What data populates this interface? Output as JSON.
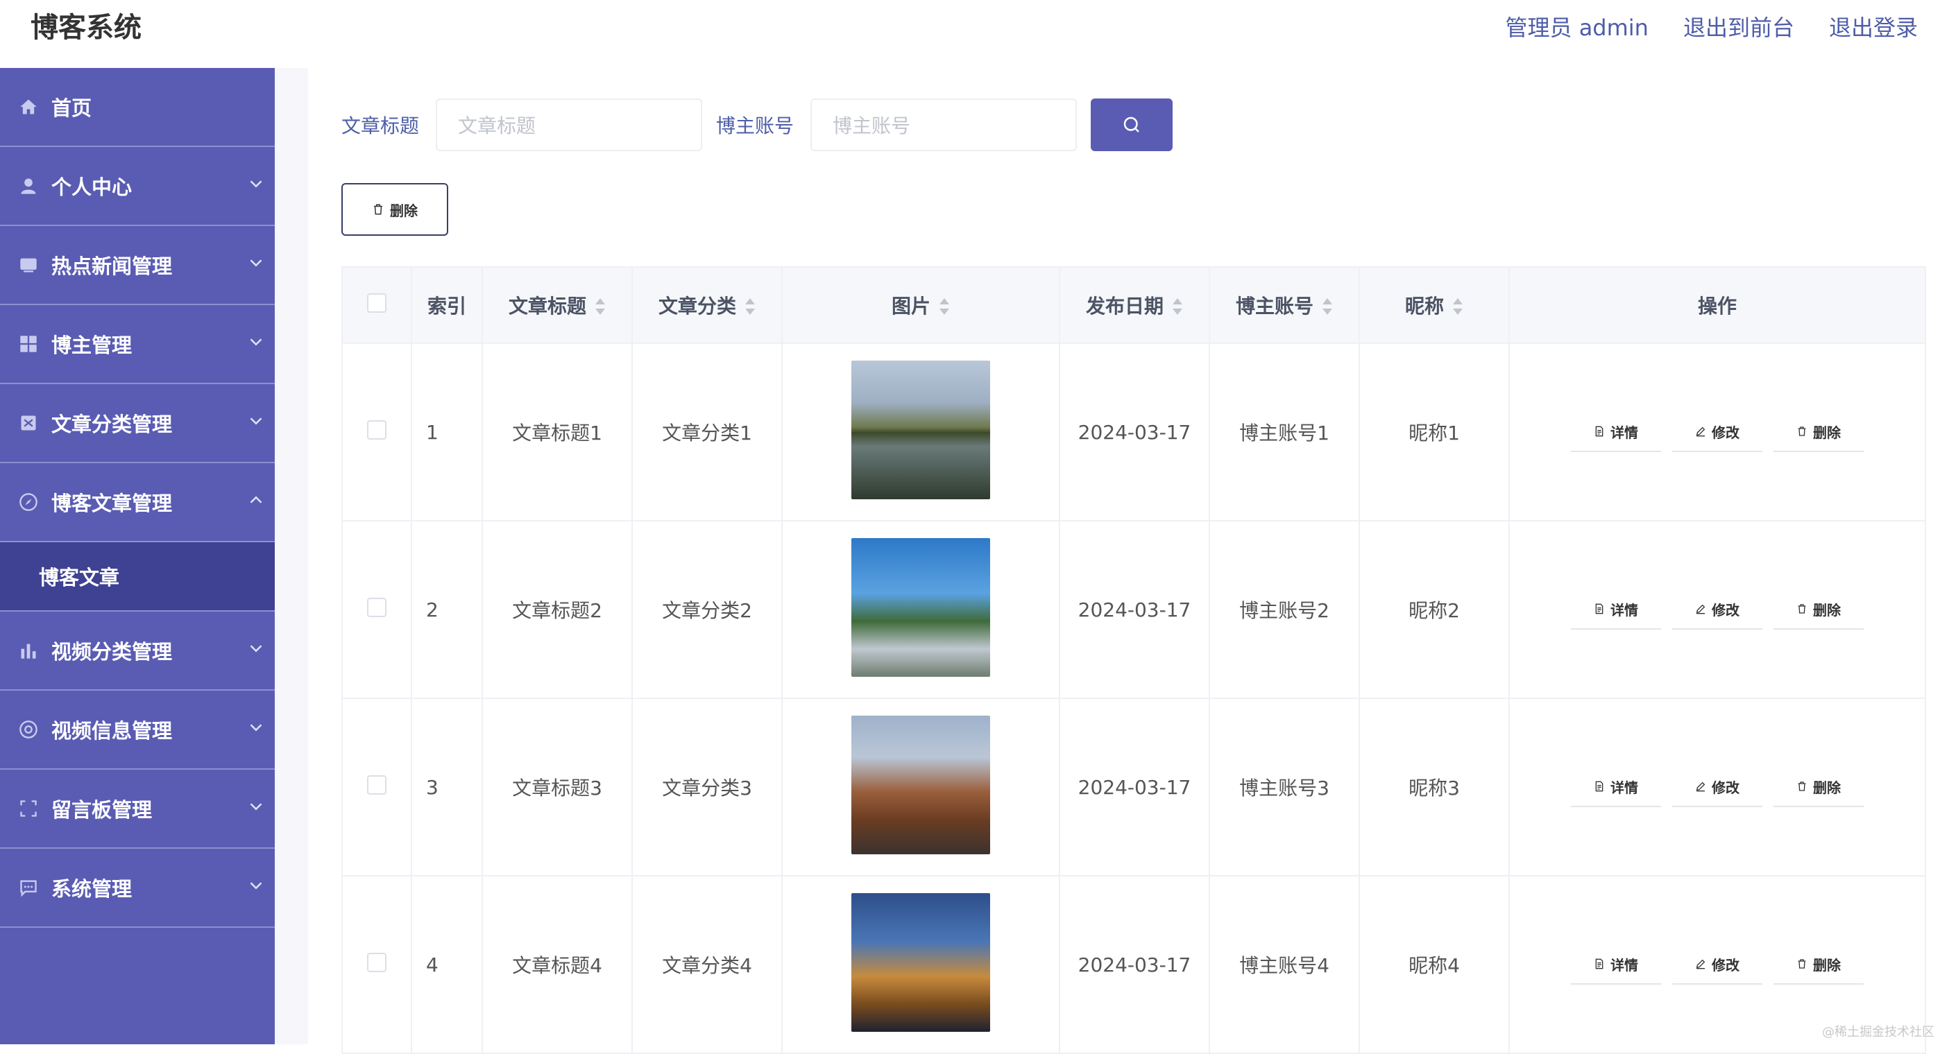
{
  "header": {
    "brand": "博客系统",
    "admin_label": "管理员 admin",
    "front_link": "退出到前台",
    "logout_link": "退出登录"
  },
  "sidebar": {
    "items": [
      {
        "label": "首页",
        "icon": "home-icon"
      },
      {
        "label": "个人中心",
        "icon": "user-icon"
      },
      {
        "label": "热点新闻管理",
        "icon": "news-icon"
      },
      {
        "label": "博主管理",
        "icon": "grid-icon"
      },
      {
        "label": "文章分类管理",
        "icon": "category-icon"
      },
      {
        "label": "博客文章管理",
        "icon": "compass-icon"
      },
      {
        "label": "视频分类管理",
        "icon": "bar-chart-icon"
      },
      {
        "label": "视频信息管理",
        "icon": "disc-icon"
      },
      {
        "label": "留言板管理",
        "icon": "frame-icon"
      },
      {
        "label": "系统管理",
        "icon": "chat-icon"
      }
    ],
    "active_sub": "博客文章"
  },
  "search": {
    "title_label": "文章标题",
    "title_placeholder": "文章标题",
    "account_label": "博主账号",
    "account_placeholder": "博主账号"
  },
  "toolbar": {
    "delete_label": "删除"
  },
  "table": {
    "headers": {
      "index": "索引",
      "title": "文章标题",
      "category": "文章分类",
      "image": "图片",
      "date": "发布日期",
      "account": "博主账号",
      "nickname": "昵称",
      "ops": "操作"
    },
    "rows": [
      {
        "index": "1",
        "title": "文章标题1",
        "category": "文章分类1",
        "date": "2024-03-17",
        "account": "博主账号1",
        "nickname": "昵称1"
      },
      {
        "index": "2",
        "title": "文章标题2",
        "category": "文章分类2",
        "date": "2024-03-17",
        "account": "博主账号2",
        "nickname": "昵称2"
      },
      {
        "index": "3",
        "title": "文章标题3",
        "category": "文章分类3",
        "date": "2024-03-17",
        "account": "博主账号3",
        "nickname": "昵称3"
      },
      {
        "index": "4",
        "title": "文章标题4",
        "category": "文章分类4",
        "date": "2024-03-17",
        "account": "博主账号4",
        "nickname": "昵称4"
      }
    ],
    "ops": {
      "detail": "详情",
      "edit": "修改",
      "delete": "删除"
    }
  },
  "watermark": "@稀土掘金技术社区"
}
